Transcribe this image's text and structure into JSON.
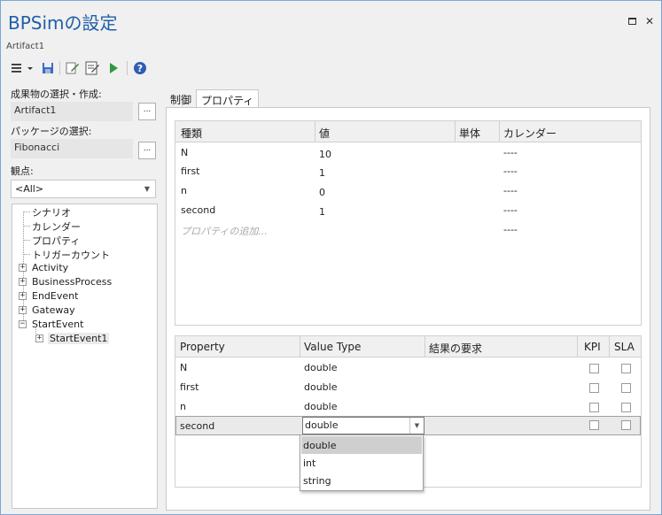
{
  "window": {
    "title": "BPSimの設定",
    "subtitle": "Artifact1",
    "maximize_icon": "maximize-icon",
    "close_label": "✕"
  },
  "toolbar": {
    "icons": [
      "menu-icon",
      "save-icon",
      "edit-icon",
      "edit-doc-icon",
      "run-icon",
      "help-icon"
    ]
  },
  "left": {
    "artifact_label": "成果物の選択・作成:",
    "artifact_value": "Artifact1",
    "package_label": "パッケージの選択:",
    "package_value": "Fibonacci",
    "browse_label": "...",
    "viewpoint_label": "観点:",
    "viewpoint_value": "<All>",
    "tree": [
      {
        "label": "シナリオ",
        "expandable": false,
        "level": 0
      },
      {
        "label": "カレンダー",
        "expandable": false,
        "level": 0
      },
      {
        "label": "プロパティ",
        "expandable": false,
        "level": 0
      },
      {
        "label": "トリガーカウント",
        "expandable": false,
        "level": 0
      },
      {
        "label": "Activity",
        "expandable": true,
        "level": 0
      },
      {
        "label": "BusinessProcess",
        "expandable": true,
        "level": 0
      },
      {
        "label": "EndEvent",
        "expandable": true,
        "level": 0
      },
      {
        "label": "Gateway",
        "expandable": true,
        "level": 0
      },
      {
        "label": "StartEvent",
        "expandable": false,
        "expanded": true,
        "level": 0
      },
      {
        "label": "StartEvent1",
        "expandable": true,
        "level": 1
      }
    ]
  },
  "tabs": [
    {
      "label": "制御",
      "active": false
    },
    {
      "label": "プロパティ",
      "active": true
    }
  ],
  "properties_grid": {
    "columns": [
      "種類",
      "値",
      "単体",
      "カレンダー"
    ],
    "rows": [
      {
        "type": "N",
        "value": "10",
        "unit": "",
        "calendar": "----"
      },
      {
        "type": "first",
        "value": "1",
        "unit": "",
        "calendar": "----"
      },
      {
        "type": "n",
        "value": "0",
        "unit": "",
        "calendar": "----"
      },
      {
        "type": "second",
        "value": "1",
        "unit": "",
        "calendar": "----"
      }
    ],
    "add_placeholder": "プロパティの追加...",
    "add_calendar": "----"
  },
  "result_grid": {
    "columns": [
      "Property",
      "Value Type",
      "結果の要求",
      "KPI",
      "SLA"
    ],
    "rows": [
      {
        "property": "N",
        "value_type": "double",
        "kpi": false,
        "sla": false
      },
      {
        "property": "first",
        "value_type": "double",
        "kpi": false,
        "sla": false
      },
      {
        "property": "n",
        "value_type": "double",
        "kpi": false,
        "sla": false
      },
      {
        "property": "second",
        "value_type": "double",
        "kpi": false,
        "sla": false
      }
    ],
    "editor_value": "double",
    "dropdown_options": [
      "double",
      "int",
      "string"
    ],
    "dropdown_selected": "double"
  },
  "colors": {
    "title": "#1f5fa8",
    "border": "#7aa7d8",
    "selected_option": "#cfcfcf"
  }
}
